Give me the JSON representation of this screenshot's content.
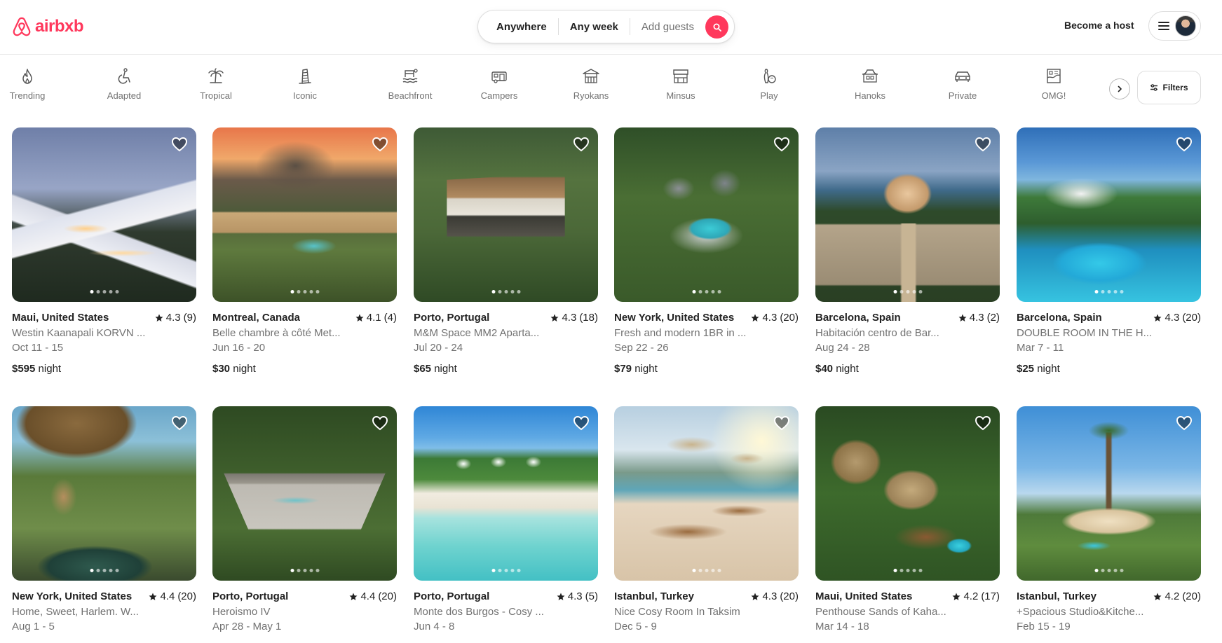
{
  "header": {
    "logo_text": "airbxb",
    "search": {
      "anywhere": "Anywhere",
      "any_week": "Any week",
      "add_guests": "Add guests"
    },
    "become_host": "Become a host"
  },
  "categories": [
    {
      "label": "Trending",
      "icon": "flame-icon"
    },
    {
      "label": "Adapted",
      "icon": "wheelchair-icon"
    },
    {
      "label": "Tropical",
      "icon": "palm-tree-icon"
    },
    {
      "label": "Iconic",
      "icon": "leaning-tower-icon"
    },
    {
      "label": "Beachfront",
      "icon": "beach-icon"
    },
    {
      "label": "Campers",
      "icon": "camper-icon"
    },
    {
      "label": "Ryokans",
      "icon": "ryokan-icon"
    },
    {
      "label": "Minsus",
      "icon": "minsu-house-icon"
    },
    {
      "label": "Play",
      "icon": "bowling-icon"
    },
    {
      "label": "Hanoks",
      "icon": "hanok-icon"
    },
    {
      "label": "Private",
      "icon": "private-room-icon"
    },
    {
      "label": "OMG!",
      "icon": "omg-house-icon"
    }
  ],
  "filters_label": "Filters",
  "listings": [
    {
      "location": "Maui, United States",
      "rating": "4.3",
      "reviews": "(9)",
      "title": "Westin Kaanapali KORVN ...",
      "dates": "Oct 11 - 15",
      "price": "$595",
      "price_unit": "night"
    },
    {
      "location": "Montreal, Canada",
      "rating": "4.1",
      "reviews": "(4)",
      "title": "Belle chambre à côté Met...",
      "dates": "Jun 16 - 20",
      "price": "$30",
      "price_unit": "night"
    },
    {
      "location": "Porto, Portugal",
      "rating": "4.3",
      "reviews": "(18)",
      "title": "M&M Space MM2 Aparta...",
      "dates": "Jul 20 - 24",
      "price": "$65",
      "price_unit": "night"
    },
    {
      "location": "New York, United States",
      "rating": "4.3",
      "reviews": "(20)",
      "title": "Fresh and modern 1BR in ...",
      "dates": "Sep 22 - 26",
      "price": "$79",
      "price_unit": "night"
    },
    {
      "location": "Barcelona, Spain",
      "rating": "4.3",
      "reviews": "(2)",
      "title": "Habitación centro de Bar...",
      "dates": "Aug 24 - 28",
      "price": "$40",
      "price_unit": "night"
    },
    {
      "location": "Barcelona, Spain",
      "rating": "4.3",
      "reviews": "(20)",
      "title": "DOUBLE ROOM IN THE H...",
      "dates": "Mar 7 - 11",
      "price": "$25",
      "price_unit": "night"
    },
    {
      "location": "New York, United States",
      "rating": "4.4",
      "reviews": "(20)",
      "title": "Home, Sweet, Harlem. W...",
      "dates": "Aug 1 - 5",
      "price": "",
      "price_unit": ""
    },
    {
      "location": "Porto, Portugal",
      "rating": "4.4",
      "reviews": "(20)",
      "title": "Heroismo IV",
      "dates": "Apr 28 - May 1",
      "price": "",
      "price_unit": ""
    },
    {
      "location": "Porto, Portugal",
      "rating": "4.3",
      "reviews": "(5)",
      "title": "Monte dos Burgos - Cosy ...",
      "dates": "Jun 4 - 8",
      "price": "",
      "price_unit": ""
    },
    {
      "location": "Istanbul, Turkey",
      "rating": "4.3",
      "reviews": "(20)",
      "title": "Nice Cosy Room In Taksim",
      "dates": "Dec 5 - 9",
      "price": "",
      "price_unit": ""
    },
    {
      "location": "Maui, United States",
      "rating": "4.2",
      "reviews": "(17)",
      "title": "Penthouse Sands of Kaha...",
      "dates": "Mar 14 - 18",
      "price": "",
      "price_unit": ""
    },
    {
      "location": "Istanbul, Turkey",
      "rating": "4.2",
      "reviews": "(20)",
      "title": "+Spacious Studio&Kitche...",
      "dates": "Feb 15 - 19",
      "price": "",
      "price_unit": ""
    }
  ],
  "colors": {
    "brand": "#FF385C",
    "text": "#222222",
    "muted": "#717171",
    "border": "#DDDDDD"
  }
}
